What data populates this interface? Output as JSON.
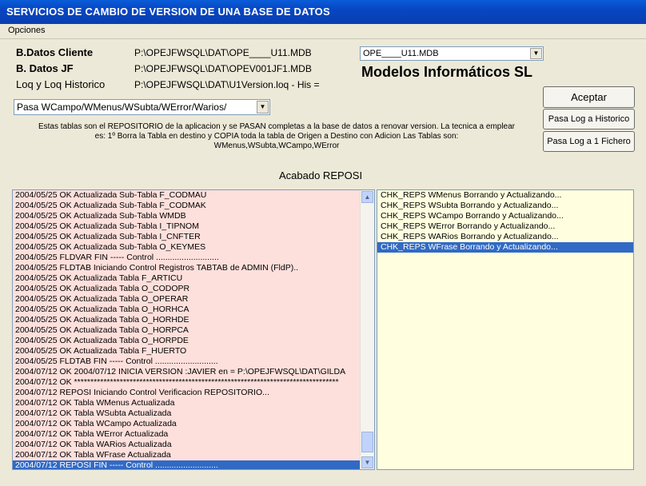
{
  "window": {
    "title": "SERVICIOS DE CAMBIO DE VERSION DE UNA BASE DE DATOS"
  },
  "menu": {
    "items": [
      "Opciones"
    ]
  },
  "fields": {
    "cliente_label": "B.Datos Cliente",
    "cliente_path": "P:\\OPEJFWSQL\\DAT\\OPE____U11.MDB",
    "jf_label": "B. Datos JF",
    "jf_path": "P:\\OPEJFWSQL\\DAT\\OPEV001JF1.MDB",
    "log_label": "Loq y Loq Historico",
    "log_path": "P:\\OPEJFWSQL\\DAT\\U1Version.loq - His ="
  },
  "db_combo": {
    "value": "OPE____U11.MDB"
  },
  "brand": "Modelos Informáticos SL",
  "tables_combo": {
    "value": "Pasa WCampo/WMenus/WSubta/WError/Warios/"
  },
  "description": {
    "line1": "Estas tablas son el REPOSITORIO de la aplicacion y se PASAN completas a la base de datos a renovar version. La tecnica a emplear",
    "line2": "es:  1º Borra la Tabla en destino y COPIA toda la tabla de Origen a Destino con Adicion Las Tablas son:",
    "line3": "WMenus,WSubta,WCampo,WError"
  },
  "buttons": {
    "accept": "Aceptar",
    "log_historico": "Pasa Log a Historico",
    "log_fichero": "Pasa Log a 1 Fichero"
  },
  "status": "Acabado REPOSI",
  "log_lines": [
    "2004/05/25 OK Actualizada Sub-Tabla F_CODMAU",
    "2004/05/25 OK Actualizada Sub-Tabla F_CODMAK",
    "2004/05/25 OK Actualizada Sub-Tabla WMDB",
    "2004/05/25 OK Actualizada Sub-Tabla I_TIPNOM",
    "2004/05/25 OK Actualizada Sub-Tabla I_CNFTER",
    "2004/05/25 OK Actualizada Sub-Tabla O_KEYMES",
    "2004/05/25 FLDVAR FIN ----- Control ...........................",
    "2004/05/25 FLDTAB Iniciando Control Registros TABTAB de ADMIN (FldP)..",
    "2004/05/25 OK Actualizada Tabla F_ARTICU",
    "2004/05/25 OK Actualizada Tabla O_CODOPR",
    "2004/05/25 OK Actualizada Tabla O_OPERAR",
    "2004/05/25 OK Actualizada Tabla O_HORHCA",
    "2004/05/25 OK Actualizada Tabla O_HORHDE",
    "2004/05/25 OK Actualizada Tabla O_HORPCA",
    "2004/05/25 OK Actualizada Tabla O_HORPDE",
    "2004/05/25 OK Actualizada Tabla F_HUERTO",
    "2004/05/25 FLDTAB FIN ----- Control ...........................",
    "2004/07/12 OK 2004/07/12 INICIA VERSION :JAVIER en = P:\\OPEJFWSQL\\DAT\\GILDA",
    "2004/07/12 OK *********************************************************************************",
    "2004/07/12 REPOSI Iniciando Control Verificacion REPOSITORIO...",
    "2004/07/12 OK Tabla WMenus Actualizada",
    "2004/07/12 OK Tabla WSubta Actualizada",
    "2004/07/12 OK Tabla WCampo Actualizada",
    "2004/07/12 OK Tabla WError Actualizada",
    "2004/07/12 OK Tabla WARios Actualizada",
    "2004/07/12 OK Tabla WFrase Actualizada",
    "2004/07/12 REPOSI FIN ----- Control ..........................."
  ],
  "reps_lines": [
    "CHK_REPS WMenus Borrando y Actualizando...",
    "CHK_REPS WSubta Borrando y Actualizando...",
    "CHK_REPS WCampo Borrando y Actualizando...",
    "CHK_REPS WError Borrando y Actualizando...",
    "CHK_REPS WARios Borrando y Actualizando...",
    "CHK_REPS WFrase Borrando y Actualizando..."
  ],
  "colors": {
    "title_bar": "#0746c2",
    "selection": "#316ac5",
    "log_bg": "#fde0dc",
    "reps_bg": "#ffffe0"
  },
  "icons": {
    "combo_arrow": "chevron-down-icon",
    "scroll_up": "scroll-up-icon",
    "scroll_down": "scroll-down-icon"
  }
}
